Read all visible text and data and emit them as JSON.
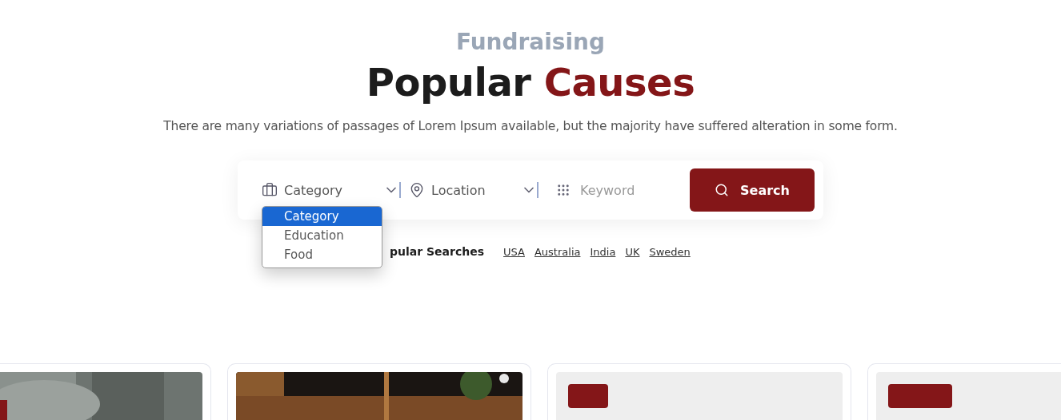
{
  "eyebrow": "Fundraising",
  "heading": {
    "plain": "Popular",
    "accent": "Causes"
  },
  "subtitle": "There are many variations of passages of Lorem Ipsum available, but the majority have suffered alteration in some form.",
  "search_bar": {
    "category": {
      "value": "Category",
      "expanded": true,
      "options": [
        {
          "label": "Category",
          "selected": true
        },
        {
          "label": "Education",
          "selected": false
        },
        {
          "label": "Food",
          "selected": false
        }
      ]
    },
    "location": {
      "value": "Location"
    },
    "keyword": {
      "placeholder": "Keyword"
    },
    "button": "Search"
  },
  "popular_searches": {
    "label": "pular Searches",
    "links": [
      "USA",
      "Australia",
      "India",
      "UK",
      "Sweden"
    ]
  },
  "cards": [
    {
      "kind": "picture"
    },
    {
      "kind": "picture"
    },
    {
      "kind": "placeholder"
    },
    {
      "kind": "placeholder"
    }
  ]
}
